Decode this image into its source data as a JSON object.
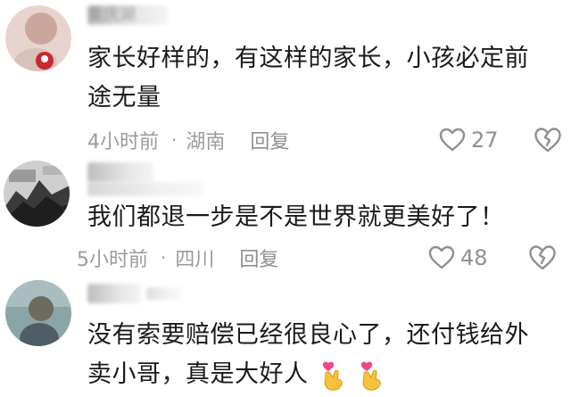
{
  "comments": [
    {
      "name": "重庆湖",
      "text_line1": "家长好样的，有这样的家长，小孩必定前",
      "text_line2": "途无量",
      "time": "4小时前",
      "location": "湖南",
      "reply": "回复",
      "likes": "27"
    },
    {
      "text": "我们都退一步是不是世界就更美好了！",
      "time": "5小时前",
      "location": "四川",
      "reply": "回复",
      "likes": "48"
    },
    {
      "text_line1": "没有索要赔偿已经很良心了，还付钱给外",
      "text_line2": "卖小哥，真是大好人",
      "emoji": [
        "finger-heart-emoji",
        "finger-heart-emoji"
      ]
    }
  ],
  "icons": {
    "like": "heart-outline-icon",
    "dislike": "broken-heart-icon"
  },
  "colors": {
    "text": "#1a1a1a",
    "meta": "#9b9b9b"
  }
}
